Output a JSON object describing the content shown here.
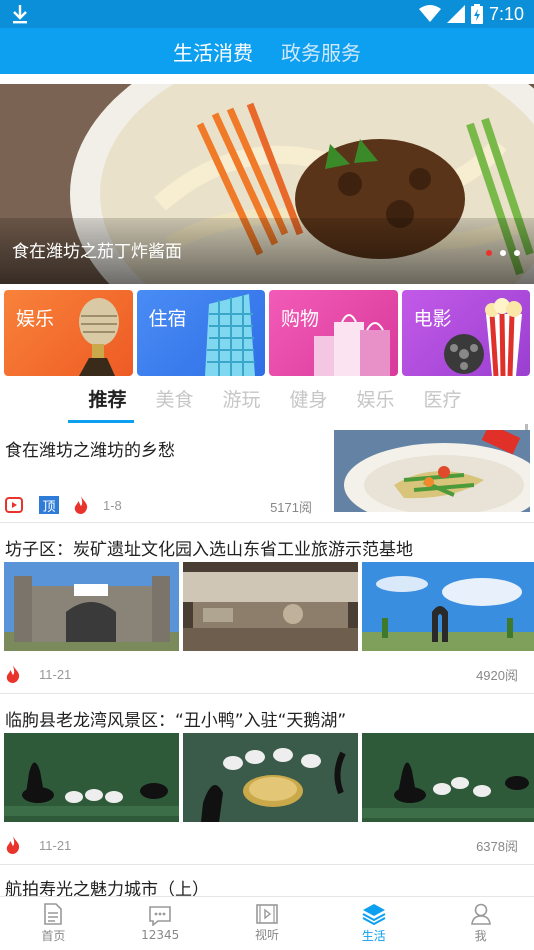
{
  "status_bar": {
    "time": "7:10",
    "icons": [
      "download-icon",
      "wifi-icon",
      "signal-icon",
      "battery-icon"
    ]
  },
  "top_tabs": [
    {
      "label": "生活消费",
      "active": true
    },
    {
      "label": "政务服务",
      "active": false
    }
  ],
  "banner": {
    "caption": "食在潍坊之茄丁炸酱面",
    "dot_count": 3,
    "active_dot": 0
  },
  "categories": [
    {
      "label": "娱乐",
      "icon": "microphone-icon",
      "color": "#f26b2f"
    },
    {
      "label": "住宿",
      "icon": "building-icon",
      "color": "#3b7ef0"
    },
    {
      "label": "购物",
      "icon": "shopping-bags-icon",
      "color": "#e84ca8"
    },
    {
      "label": "电影",
      "icon": "popcorn-film-icon",
      "color": "#b34fd8"
    }
  ],
  "channels": [
    {
      "label": "推荐",
      "active": true
    },
    {
      "label": "美食",
      "active": false
    },
    {
      "label": "游玩",
      "active": false
    },
    {
      "label": "健身",
      "active": false
    },
    {
      "label": "娱乐",
      "active": false
    },
    {
      "label": "医疗",
      "active": false
    }
  ],
  "articles": [
    {
      "title": "食在潍坊之潍坊的乡愁",
      "tags": [
        "video-icon",
        "top-icon",
        "hot-icon"
      ],
      "top_label": "顶",
      "date": "1-8",
      "reads": "5171阅"
    },
    {
      "title": "坊子区：炭矿遗址文化园入选山东省工业旅游示范基地",
      "tags": [
        "hot-icon"
      ],
      "date": "11-21",
      "reads": "4920阅"
    },
    {
      "title": "临朐县老龙湾风景区：“丑小鸭”入驻“天鹅湖”",
      "tags": [
        "hot-icon"
      ],
      "date": "11-21",
      "reads": "6378阅"
    },
    {
      "title": "航拍寿光之魅力城市（上）"
    }
  ],
  "bottom_nav": [
    {
      "label": "首页",
      "icon": "document-icon",
      "active": false
    },
    {
      "label": "12345",
      "icon": "chat-bubble-icon",
      "active": false
    },
    {
      "label": "视听",
      "icon": "film-play-icon",
      "active": false
    },
    {
      "label": "生活",
      "icon": "layers-icon",
      "active": true
    },
    {
      "label": "我",
      "icon": "user-icon",
      "active": false
    }
  ],
  "colors": {
    "primary": "#0d9ff0",
    "hot": "#e8342c"
  }
}
